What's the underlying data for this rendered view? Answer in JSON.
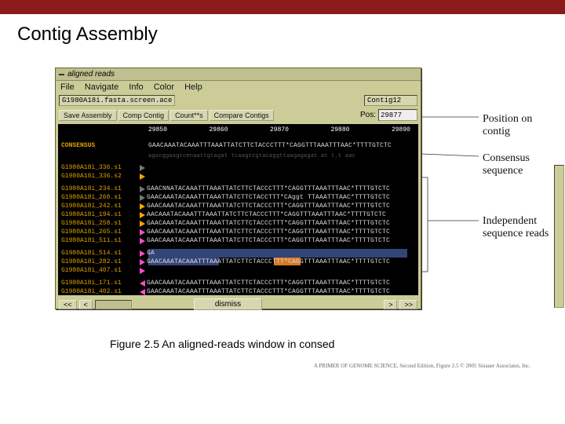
{
  "slide_title": "Contig Assembly",
  "caption": "Figure 2.5  An aligned-reads window in consed",
  "credit": "A PRIMER OF GENOME SCIENCE, Second Edition, Figure 2.5  © 2005 Sinauer Associates, Inc.",
  "window": {
    "title": "aligned reads",
    "menu": [
      "File",
      "Navigate",
      "Info",
      "Color",
      "Help"
    ],
    "file_name": "G1980A18i.fasta.screen.ace",
    "contig": "Contig12",
    "buttons": {
      "save": "Save Assembly",
      "comp": "Comp Contig",
      "count": "Count**s",
      "compare": "Compare Contigs"
    },
    "pos_label": "Pos:",
    "pos_value": "29877",
    "dismiss": "dismiss",
    "nav_left2": "<<",
    "nav_left1": "<",
    "nav_right1": ">",
    "nav_right2": ">>"
  },
  "ruler": [
    "29850",
    "29860",
    "29870",
    "29880",
    "29890"
  ],
  "consensus_label": "CONSENSUS",
  "consensus_seq": "GAACAAATACAAATTTAAATTATCTTCTACCCTTT*CAGGTTTAAATTTAAC*TTTTGTCTC",
  "grey_band": "agacggaagtcenaattgtagat tcaagtcgtacaggttaagagagat at t.t aac",
  "reads": [
    {
      "id": "G1980A18i_336.s1",
      "col": "#777",
      "dir": "r",
      "seq": "                                                              "
    },
    {
      "id": "G1980A18i_336.s2",
      "col": "#ffa500",
      "dir": "r",
      "seq": ""
    },
    {
      "id": "G1980A18i_234.s1",
      "col": "#777",
      "dir": "r",
      "seq": "GAACNNATACAAATTTAAATTATCTTCTACCCTTT*CAGGTTTAAATTTAAC*TTTTGTCTC"
    },
    {
      "id": "G1980A18i_260.s1",
      "col": "#777",
      "dir": "r",
      "seq": "GAACAAATACAAATTTAAATTATCTTCTACCTTT*CAggt TTAAATTTAAC*TTTTGTCTC"
    },
    {
      "id": "G1980A18i_242.s1",
      "col": "#ffa500",
      "dir": "r",
      "seq": "GAACAAATACAAATTTAAATTATCTTCTACCCTTT*CAGGTTTAAATTTAAC*TTTTGTCTC"
    },
    {
      "id": "G1980A18i_194.s1",
      "col": "#ffa500",
      "dir": "r",
      "seq": "AACAAATACAAATTTAAATTATCTTCTACCCTTT*CAGGTTTAAATTTAAC*TTTTGTCTC"
    },
    {
      "id": "G1980A18i_258.s1",
      "col": "#ffa500",
      "dir": "r",
      "seq": "GAACAAATACAAATTTAAATTATCTTCTACCCTTT*CAGGTTTAAATTTAAC*TTTTGTCTC"
    },
    {
      "id": "G1980A18i_265.s1",
      "col": "#ff4fc8",
      "dir": "r",
      "seq": "GAACAAATACAAATTTAAATTATCTTCTACCCTTT*CAGGTTTAAATTTAAC*TTTTGTCTC"
    },
    {
      "id": "G1980A18i_511.s1",
      "col": "#ff4fc8",
      "dir": "r",
      "seq": "GAACAAATACAAATTTAAATTATCTTCTACCCTTT*CAGGTTTAAATTTAAC*TTTTGTCTC"
    },
    {
      "id": "G1980A18i_514.s1",
      "col": "#ff4fc8",
      "dir": "r",
      "seq": "GA"
    },
    {
      "id": "G1980A18i_282.s1",
      "col": "#ff4fc8",
      "dir": "r",
      "seq": "GAACAAATACAAATTTAAATTATCTTCTACCCTTT*CAGGTTTAAATTTAAC*TTTTGTCTC"
    },
    {
      "id": "G1980A18i_407.s1",
      "col": "#ff4fc8",
      "dir": "r",
      "seq": ""
    },
    {
      "id": "G1980A18i_171.s1",
      "col": "#ff4fc8",
      "dir": "l",
      "seq": "GAACAAATACAAATTTAAATTATCTTCTACCCTTT*CAGGTTTAAATTTAAC*TTTTGTCTC"
    },
    {
      "id": "G1980A18i_402.s1",
      "col": "#ff4fc8",
      "dir": "l",
      "seq": "GAACAAATACAAATTTAAATTATCTTCTACCCTTT*CAGGTTTAAATTTAAC*TTTTGTCTC"
    }
  ],
  "annotations": {
    "pos": "Position on\ncontig",
    "consensus": "Consensus\nsequence",
    "reads": "Independent\nsequence reads"
  }
}
